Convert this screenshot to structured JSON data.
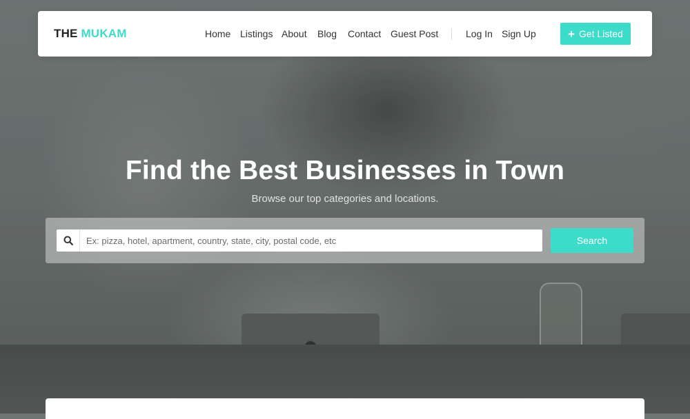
{
  "brand": {
    "part1": "THE",
    "part2": "MUKAM"
  },
  "nav": {
    "items": [
      {
        "label": "Home"
      },
      {
        "label": "Listings"
      },
      {
        "label": "About"
      },
      {
        "label": "Blog"
      },
      {
        "label": "Contact"
      },
      {
        "label": "Guest Post"
      }
    ],
    "login_label": "Log In",
    "signup_label": "Sign Up",
    "cta_label": "Get Listed",
    "cta_icon": "plus-icon"
  },
  "hero": {
    "title": "Find the Best Businesses in Town",
    "subtitle": "Browse our top categories and locations."
  },
  "search": {
    "placeholder": "Ex: pizza, hotel, apartment, country, state, city, postal code, etc",
    "value": "",
    "icon": "search-icon",
    "button_label": "Search"
  },
  "colors": {
    "accent": "#3ddbc9",
    "text_dark": "#333333",
    "white": "#ffffff"
  }
}
